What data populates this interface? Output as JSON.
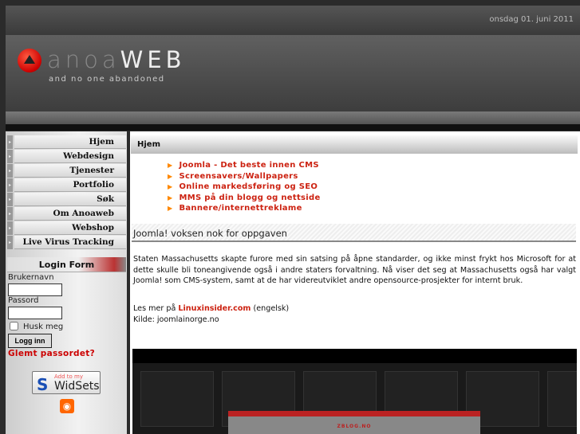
{
  "header": {
    "date": "onsdag 01. juni 2011",
    "logo_light": "anoa",
    "logo_bold": "WEB",
    "tagline": "and no one abandoned"
  },
  "menu": [
    {
      "label": "Hjem"
    },
    {
      "label": "Webdesign"
    },
    {
      "label": "Tjenester"
    },
    {
      "label": "Portfolio"
    },
    {
      "label": "Søk"
    },
    {
      "label": "Om Anoaweb"
    },
    {
      "label": "Webshop"
    },
    {
      "label": "Live Virus Tracking"
    }
  ],
  "login": {
    "title": "Login Form",
    "username_label": "Brukernavn",
    "password_label": "Passord",
    "remember_label": "Husk meg",
    "submit": "Logg inn",
    "forgot": "Glemt passordet?"
  },
  "widsets": {
    "add": "Add to my",
    "name": "WidSets"
  },
  "main": {
    "breadcrumb": "Hjem",
    "links": [
      "Joomla - Det beste innen CMS",
      "Screensavers/Wallpapers",
      "Online markedsføring og SEO",
      "MMS på din blogg og nettside",
      "Bannere/internettreklame"
    ],
    "article": {
      "title": "Joomla! voksen nok for oppgaven",
      "body": "Staten Massachusetts skapte furore med sin satsing på åpne standarder, og ikke minst frykt hos Microsoft for at dette skulle bli toneangivende også i andre staters forvaltning.  Nå viser det seg at Massachusetts også har valgt Joomla! som CMS-system, samt at de har videreutviklet andre opensource-prosjekter for internt bruk.",
      "read_more_prefix": "Les mer på",
      "read_more_link": "Linuxinsider.com",
      "read_more_suffix": "(engelsk)",
      "source": "Kilde: joomlainorge.no"
    },
    "preview_title": "ZBLOG.NO"
  }
}
